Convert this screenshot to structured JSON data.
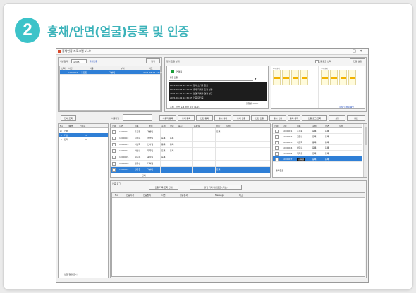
{
  "step_number": "2",
  "title": "홍채/안면(얼굴)등록 및 인증",
  "window": {
    "title": "홍채인증 프로그램 v1.0",
    "controls": [
      "—",
      "□",
      "✕"
    ]
  },
  "top_left": {
    "search_label": "사번검색",
    "search_value": "12345",
    "search_mode": "홍채인증",
    "search_button": "검색",
    "columns": [
      "선택",
      "사번",
      "이름",
      "부서",
      "비고"
    ],
    "selected_row": [
      "",
      "1000001",
      "홍길동",
      "기술팀",
      "2021-03-01 12:30"
    ]
  },
  "device": {
    "title": "장치 연결 상태",
    "status_label": "연결됨",
    "option_label": "인증모드 선택",
    "connect_button": "연결 설정",
    "dropdown_value": "통합인증",
    "log_lines": [
      "2021-03-01 12:30:01 장치 초기화 완료",
      "2021-03-01 12:30:02 홍채 카메라 연결 성공",
      "2021-03-01 12:30:03 안면 카메라 연결 성공",
      "2021-03-01 12:30:05 인증 대기중"
    ],
    "progress_label": "진행률 100%",
    "footer_text": "홍채 · 안면 등록 상태 정상 (1/1)",
    "right_left_caption": "좌측 홍채",
    "right_right_caption": "우측 홍채",
    "right_status": "정상 연결됨 확인"
  },
  "toolbar": {
    "left_button": "전체 조회",
    "name_label": "사용자명",
    "buttons": [
      "사용자 등록",
      "홍채 등록",
      "안면 등록",
      "동시 등록",
      "홍채 인증",
      "안면 인증",
      "동시 인증",
      "등록 해제",
      "인증 로그 조회",
      "설정",
      "종료"
    ]
  },
  "left_tree": {
    "columns": [
      "No",
      "그룹명",
      "인원수"
    ],
    "items": [
      {
        "no": "",
        "name": "전체",
        "count": ""
      },
      {
        "no": "1",
        "name": "기본",
        "count": "5"
      },
      {
        "no": "2",
        "name": "관리",
        "count": "1"
      }
    ],
    "footer": "인원 현황 표시"
  },
  "user_table": {
    "columns": [
      "선택",
      "사번",
      "이름",
      "부서",
      "홍채",
      "안면",
      "동시",
      "등록일",
      "비고",
      "상태"
    ],
    "rows": [
      {
        "id": "1000001",
        "name": "홍길동",
        "dept": "개발팀",
        "a": "",
        "b": "",
        "c": "등록"
      },
      {
        "id": "1000002",
        "name": "김철수",
        "dept": "영업팀",
        "a": "등록",
        "b": "등록",
        "c": ""
      },
      {
        "id": "1000003",
        "name": "이영희",
        "dept": "인사팀",
        "a": "등록",
        "b": "등록",
        "c": ""
      },
      {
        "id": "1000004",
        "name": "박민수",
        "dept": "재무팀",
        "a": "등록",
        "b": "등록",
        "c": ""
      },
      {
        "id": "1000005",
        "name": "최지우",
        "dept": "총무팀",
        "a": "등록",
        "b": "",
        "c": ""
      },
      {
        "id": "1000006",
        "name": "정우성",
        "dept": "기획팀",
        "a": "",
        "b": "",
        "c": ""
      },
      {
        "id": "1000007",
        "name": "강동원",
        "dept": "기술팀",
        "a": "",
        "b": "",
        "c": "등록",
        "selected": true
      }
    ],
    "footer_label": "전체 7"
  },
  "right_table": {
    "columns": [
      "선택",
      "사번",
      "이름",
      "홍채",
      "안면",
      "상태"
    ],
    "rows": [
      {
        "id": "1000001",
        "name": "홍길동",
        "a": "등록",
        "b": "등록"
      },
      {
        "id": "1000002",
        "name": "김철수",
        "a": "등록",
        "b": "등록"
      },
      {
        "id": "1000003",
        "name": "이영희",
        "a": "등록",
        "b": "등록"
      },
      {
        "id": "1000004",
        "name": "박민수",
        "a": "등록",
        "b": "등록"
      },
      {
        "id": "1000005",
        "name": "최지우",
        "a": "등록",
        "b": "등록"
      },
      {
        "id": "1000007",
        "name": "강동원",
        "a": "등록",
        "b": "등록",
        "selected": true
      }
    ],
    "footer": "등록완료"
  },
  "log": {
    "label": "인증 로그",
    "buttons": [
      "인증 기록 조회 전체",
      "출입 기록 다운로드 (엑셀)"
    ],
    "columns": [
      "No",
      "인증시각",
      "인증방식",
      "사번",
      "인증결과",
      "Message",
      "비고"
    ]
  }
}
